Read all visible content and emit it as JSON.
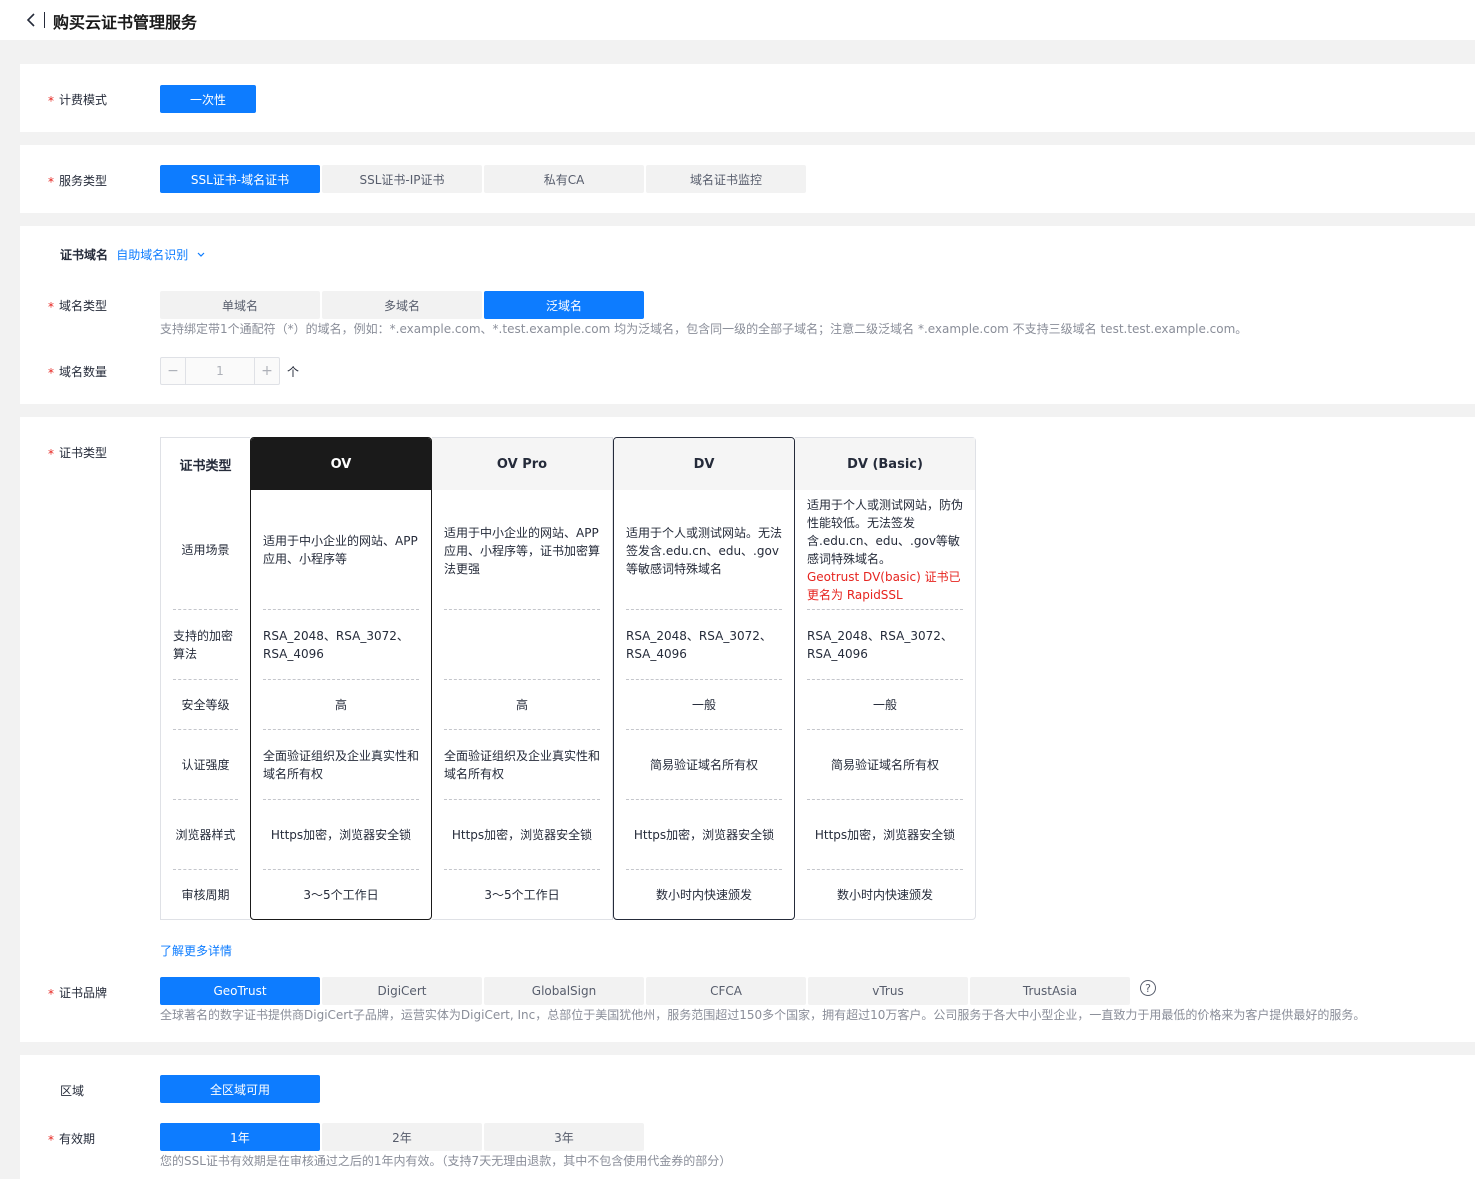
{
  "page": {
    "title": "购买云证书管理服务"
  },
  "billing": {
    "label": "计费模式",
    "option": "一次性"
  },
  "service_type": {
    "label": "服务类型",
    "options": [
      "SSL证书-域名证书",
      "SSL证书-IP证书",
      "私有CA",
      "域名证书监控"
    ]
  },
  "domain": {
    "section_label": "证书域名",
    "auto_link": "自助域名识别",
    "type_label": "域名类型",
    "types": [
      "单域名",
      "多域名",
      "泛域名"
    ],
    "type_hint": "支持绑定带1个通配符（*）的域名，例如：*.example.com、*.test.example.com 均为泛域名，包含同一级的全部子域名；注意二级泛域名 *.example.com 不支持三级域名 test.test.example.com。",
    "count_label": "域名数量",
    "count_value": "1",
    "count_unit": "个",
    "minus": "−",
    "plus": "+"
  },
  "cert_type": {
    "label": "证书类型",
    "header_col": "证书类型",
    "row_labels": [
      "适用场景",
      "支持的加密算法",
      "安全等级",
      "认证强度",
      "浏览器样式",
      "审核周期"
    ],
    "columns": [
      {
        "name": "OV",
        "scene": "适用于中小企业的网站、APP应用、小程序等",
        "scene_note": "",
        "algo": "RSA_2048、RSA_3072、RSA_4096",
        "level": "高",
        "auth": "全面验证组织及企业真实性和域名所有权",
        "browser": "Https加密，浏览器安全锁",
        "period": "3～5个工作日"
      },
      {
        "name": "OV Pro",
        "scene": "适用于中小企业的网站、APP应用、小程序等，证书加密算法更强",
        "scene_note": "",
        "algo": "",
        "level": "高",
        "auth": "全面验证组织及企业真实性和域名所有权",
        "browser": "Https加密，浏览器安全锁",
        "period": "3～5个工作日"
      },
      {
        "name": "DV",
        "scene": "适用于个人或测试网站。无法签发含.edu.cn、edu、.gov等敏感词特殊域名",
        "scene_note": "",
        "algo": "RSA_2048、RSA_3072、RSA_4096",
        "level": "一般",
        "auth": "简易验证域名所有权",
        "browser": "Https加密，浏览器安全锁",
        "period": "数小时内快速颁发"
      },
      {
        "name": "DV (Basic)",
        "scene": "适用于个人或测试网站，防伪性能较低。无法签发含.edu.cn、edu、.gov等敏感词特殊域名。",
        "scene_note": "Geotrust DV(basic) 证书已更名为 RapidSSL",
        "algo": "RSA_2048、RSA_3072、RSA_4096",
        "level": "一般",
        "auth": "简易验证域名所有权",
        "browser": "Https加密，浏览器安全锁",
        "period": "数小时内快速颁发"
      }
    ],
    "more_link": "了解更多详情"
  },
  "brand": {
    "label": "证书品牌",
    "options": [
      "GeoTrust",
      "DigiCert",
      "GlobalSign",
      "CFCA",
      "vTrus",
      "TrustAsia"
    ],
    "help": "?",
    "hint": "全球著名的数字证书提供商DigiCert子品牌，运营实体为DigiCert, Inc，总部位于美国犹他州，服务范围超过150多个国家，拥有超过10万客户。公司服务于各大中小型企业，一直致力于用最低的价格来为客户提供最好的服务。"
  },
  "region": {
    "label": "区域",
    "option": "全区域可用"
  },
  "validity": {
    "label": "有效期",
    "options": [
      "1年",
      "2年",
      "3年"
    ],
    "hint": "您的SSL证书有效期是在审核通过之后的1年内有效。（支持7天无理由退款，其中不包含使用代金券的部分）"
  },
  "colors": {
    "accent": "#0d7cff",
    "required": "#e6241f",
    "selected_header": "#1a1a1a"
  }
}
